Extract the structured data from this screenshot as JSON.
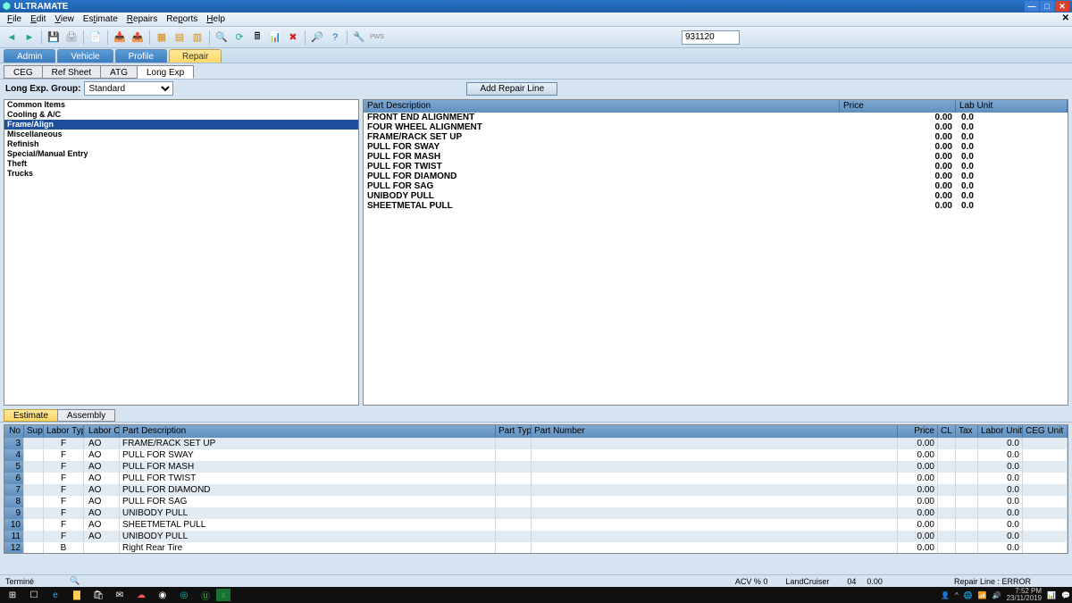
{
  "app": {
    "title": "ULTRAMATE"
  },
  "menu": {
    "items": [
      "File",
      "Edit",
      "View",
      "Estimate",
      "Repairs",
      "Reports",
      "Help"
    ]
  },
  "search": {
    "value": "931120"
  },
  "mainTabs": [
    {
      "label": "Admin",
      "active": false
    },
    {
      "label": "Vehicle",
      "active": false
    },
    {
      "label": "Profile",
      "active": false
    },
    {
      "label": "Repair",
      "active": true
    }
  ],
  "subTabs": [
    {
      "label": "CEG",
      "active": false
    },
    {
      "label": "Ref Sheet",
      "active": false
    },
    {
      "label": "ATG",
      "active": false
    },
    {
      "label": "Long Exp",
      "active": true
    }
  ],
  "group": {
    "label": "Long Exp. Group:",
    "value": "Standard"
  },
  "addRepairLabel": "Add Repair Line",
  "categories": [
    {
      "name": "Common Items",
      "selected": false
    },
    {
      "name": "Cooling & A/C",
      "selected": false
    },
    {
      "name": "Frame/Align",
      "selected": true
    },
    {
      "name": "Miscellaneous",
      "selected": false
    },
    {
      "name": "Refinish",
      "selected": false
    },
    {
      "name": "Special/Manual Entry",
      "selected": false
    },
    {
      "name": "Theft",
      "selected": false
    },
    {
      "name": "Trucks",
      "selected": false
    }
  ],
  "partsHeader": {
    "desc": "Part Description",
    "price": "Price",
    "lab": "Lab Unit"
  },
  "parts": [
    {
      "desc": "FRONT END ALIGNMENT",
      "price": "0.00",
      "lab": "0.0"
    },
    {
      "desc": "FOUR WHEEL ALIGNMENT",
      "price": "0.00",
      "lab": "0.0"
    },
    {
      "desc": "FRAME/RACK SET UP",
      "price": "0.00",
      "lab": "0.0"
    },
    {
      "desc": "PULL FOR SWAY",
      "price": "0.00",
      "lab": "0.0"
    },
    {
      "desc": "PULL FOR MASH",
      "price": "0.00",
      "lab": "0.0"
    },
    {
      "desc": "PULL FOR TWIST",
      "price": "0.00",
      "lab": "0.0"
    },
    {
      "desc": "PULL FOR DIAMOND",
      "price": "0.00",
      "lab": "0.0"
    },
    {
      "desc": "PULL FOR SAG",
      "price": "0.00",
      "lab": "0.0"
    },
    {
      "desc": "UNIBODY PULL",
      "price": "0.00",
      "lab": "0.0"
    },
    {
      "desc": "SHEETMETAL PULL",
      "price": "0.00",
      "lab": "0.0"
    }
  ],
  "bottomTabs": [
    {
      "label": "Estimate",
      "active": true
    },
    {
      "label": "Assembly",
      "active": false
    }
  ],
  "estHeader": {
    "no": "No",
    "sup": "Sup",
    "ltype": "Labor Type",
    "lop": "Labor Op",
    "desc": "Part Description",
    "ptype": "Part Type",
    "pnum": "Part Number",
    "price": "Price",
    "cl": "CL",
    "tax": "Tax",
    "lunit": "Labor Unit",
    "ceg": "CEG Unit"
  },
  "estRows": [
    {
      "no": "3",
      "sup": "",
      "ltype": "F",
      "lop": "AO",
      "desc": "FRAME/RACK SET UP",
      "price": "0.00",
      "lunit": "0.0"
    },
    {
      "no": "4",
      "sup": "",
      "ltype": "F",
      "lop": "AO",
      "desc": "PULL FOR SWAY",
      "price": "0.00",
      "lunit": "0.0"
    },
    {
      "no": "5",
      "sup": "",
      "ltype": "F",
      "lop": "AO",
      "desc": "PULL FOR MASH",
      "price": "0.00",
      "lunit": "0.0"
    },
    {
      "no": "6",
      "sup": "",
      "ltype": "F",
      "lop": "AO",
      "desc": "PULL FOR TWIST",
      "price": "0.00",
      "lunit": "0.0"
    },
    {
      "no": "7",
      "sup": "",
      "ltype": "F",
      "lop": "AO",
      "desc": "PULL FOR DIAMOND",
      "price": "0.00",
      "lunit": "0.0"
    },
    {
      "no": "8",
      "sup": "",
      "ltype": "F",
      "lop": "AO",
      "desc": "PULL FOR SAG",
      "price": "0.00",
      "lunit": "0.0"
    },
    {
      "no": "9",
      "sup": "",
      "ltype": "F",
      "lop": "AO",
      "desc": "UNIBODY PULL",
      "price": "0.00",
      "lunit": "0.0"
    },
    {
      "no": "10",
      "sup": "",
      "ltype": "F",
      "lop": "AO",
      "desc": "SHEETMETAL PULL",
      "price": "0.00",
      "lunit": "0.0"
    },
    {
      "no": "11",
      "sup": "",
      "ltype": "F",
      "lop": "AO",
      "desc": "UNIBODY PULL",
      "price": "0.00",
      "lunit": "0.0"
    },
    {
      "no": "12",
      "sup": "",
      "ltype": "B",
      "lop": "",
      "desc": "Right Rear Tire",
      "price": "0.00",
      "lunit": "0.0"
    }
  ],
  "status": {
    "left": "Terminé",
    "acv": "ACV % 0",
    "vehicle": "LandCruiser",
    "code": "04",
    "amount": "0.00",
    "repair": "Repair Line : ERROR"
  },
  "system": {
    "time": "7:52 PM",
    "date": "23/11/2019"
  }
}
